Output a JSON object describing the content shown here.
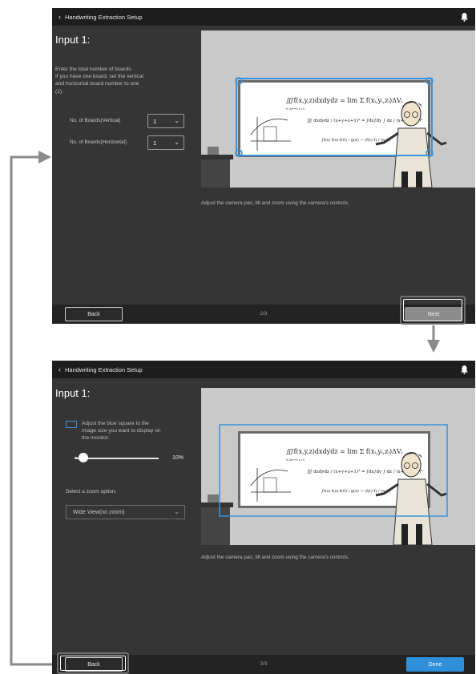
{
  "screen1": {
    "title": "Handwriting Extraction Setup",
    "heading": "Input 1:",
    "instructions": [
      "Enter the total number of boards.",
      "If you have one board, set the vertical",
      "and horizontal board number to one",
      "(1)."
    ],
    "vertical_label": "No. of Boards(Vertical)",
    "vertical_value": "1",
    "horizontal_label": "No. of Boards(Horizontal)",
    "horizontal_value": "1",
    "caption": "Adjust the camera pan, tilt and zoom using the camera's controls.",
    "back_label": "Back",
    "page": "2/3",
    "next_label": "Next"
  },
  "screen2": {
    "title": "Handwriting Extraction Setup",
    "heading": "Input 1:",
    "instructions": [
      "Adjust the blue square to the",
      "image size you want to display on",
      "the monitor."
    ],
    "slider_value_text": "10%",
    "slider_fraction": 0.1,
    "zoom_prompt": "Select a zoom option.",
    "zoom_selected": "Wide View(no zoom)",
    "caption": "Adjust the camera pan, tilt and zoom using the camera's controls.",
    "back_label": "Back",
    "page": "3/3",
    "done_label": "Done"
  },
  "board_text": {
    "l1": "∭f(x,y,z)dxdydz = lim Σ f(xᵢ,yᵢ,zᵢ)ΔVᵢ",
    "l1sub": "0                          Δv→0 i=1",
    "l2": "∭ dxdydz / (x+y+z+1)³ = ∫dx∫dy ∫ dz / (x+y+z+1)³",
    "l3": "∫f(x) f(x)-f(0) / g(x) − (f(t)-f) / (n-1)"
  },
  "colors": {
    "accent": "#2f8fd8",
    "panel": "#353535",
    "titlebar": "#1d1d1d"
  }
}
